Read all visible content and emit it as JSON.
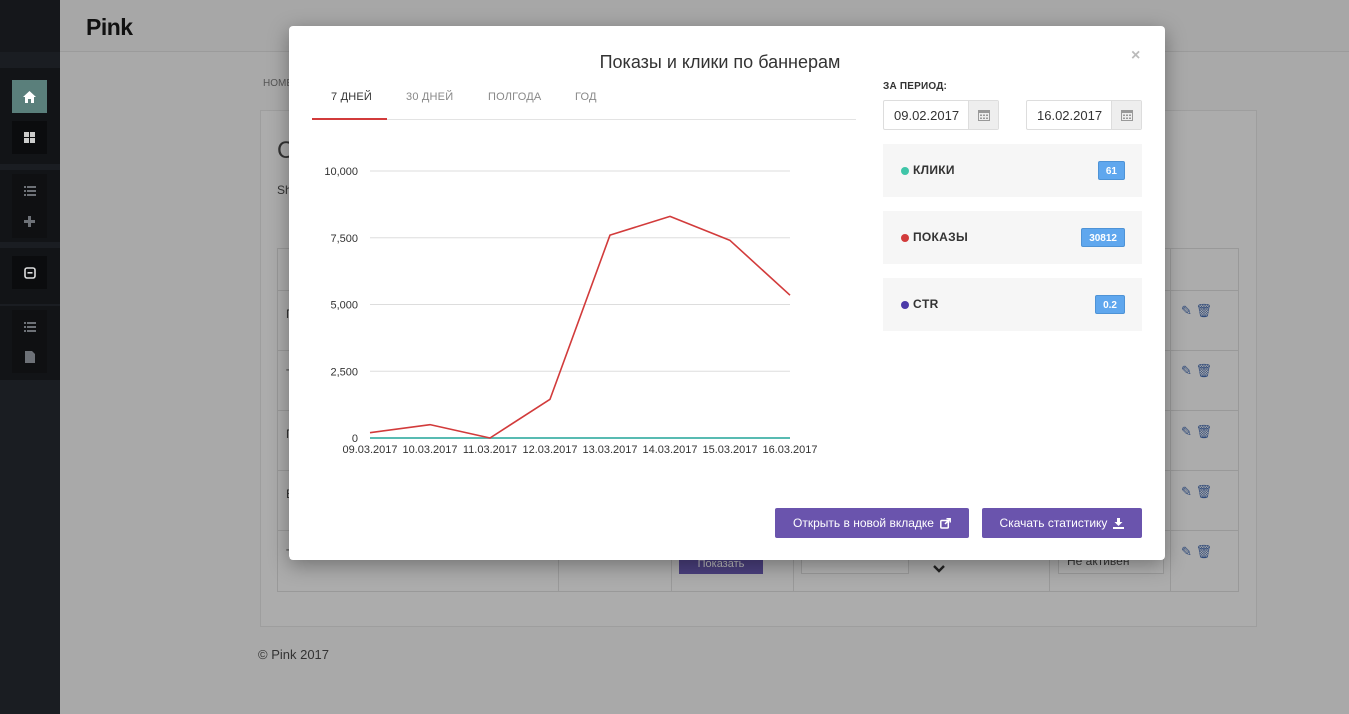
{
  "app": {
    "logo": "Pink"
  },
  "breadcrumb": "HOME",
  "background": {
    "page_title": "С",
    "page_sub": "Sh",
    "row_letters": [
      "П",
      "Т",
      "П",
      "В",
      "Т"
    ],
    "show_button": "Показать",
    "status_value": "Не активен",
    "footer": "© Pink 2017"
  },
  "modal": {
    "title": "Показы и клики по баннерам",
    "close": "×",
    "tabs": [
      {
        "label": "7 ДНЕЙ"
      },
      {
        "label": "30 ДНЕЙ"
      },
      {
        "label": "ПОЛГОДА"
      },
      {
        "label": "ГОД"
      }
    ],
    "period_label": "ЗА ПЕРИОД:",
    "date_from": "09.02.2017",
    "date_to": "16.02.2017",
    "stats": [
      {
        "label": "КЛИКИ",
        "value": "61",
        "color": "#3fc5a8"
      },
      {
        "label": "ПОКАЗЫ",
        "value": "30812",
        "color": "#d23b3b"
      },
      {
        "label": "CTR",
        "value": "0.2",
        "color": "#4b3aa8"
      }
    ],
    "btn_open": "Открыть в новой вкладке",
    "btn_download": "Скачать статистику"
  },
  "chart_data": {
    "type": "line",
    "categories": [
      "09.03.2017",
      "10.03.2017",
      "11.03.2017",
      "12.03.2017",
      "13.03.2017",
      "14.03.2017",
      "15.03.2017",
      "16.03.2017"
    ],
    "yticks": [
      0,
      2500,
      5000,
      7500,
      10000
    ],
    "ytick_labels": [
      "0",
      "2,500",
      "5,000",
      "7,500",
      "10,000"
    ],
    "ylim": [
      0,
      10000
    ],
    "grid": true,
    "series": [
      {
        "color": "#d23b3b",
        "values": [
          200,
          500,
          0,
          1450,
          7600,
          8300,
          7400,
          5350
        ]
      },
      {
        "color": "#3fc5a8",
        "values": [
          0,
          0,
          0,
          0,
          0,
          0,
          0,
          0
        ]
      },
      {
        "color": "#4b3aa8",
        "values": [
          0,
          0,
          0,
          0,
          0,
          0,
          0,
          0
        ]
      }
    ]
  }
}
